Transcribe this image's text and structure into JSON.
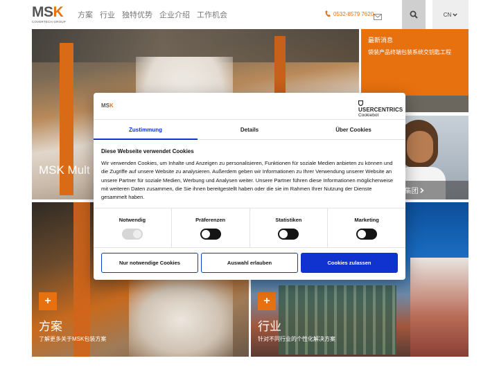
{
  "header": {
    "logo": {
      "main": "MS",
      "accent": "K",
      "sub": "COVERTECH GROUP"
    },
    "nav": [
      "方案",
      "行业",
      "独特优势",
      "企业介绍",
      "工作机会"
    ],
    "phone": "0532-8579 7620",
    "language": "CN"
  },
  "hero": {
    "title": "MSK Mult"
  },
  "news": {
    "title": "最新消息",
    "text": "袋装产品终端包装系统交钥匙工程"
  },
  "people": {
    "text": "K集团"
  },
  "tiles": [
    {
      "plus": "+",
      "title": "方案",
      "subtitle": "了解更多关于MSK包装方案"
    },
    {
      "plus": "+",
      "title": "行业",
      "subtitle": "针对不同行业的个性化解决方案"
    }
  ],
  "cookie_dialog": {
    "logo": {
      "main": "MS",
      "accent": "K"
    },
    "provider": {
      "name": "USERCENTRICS",
      "product": "Cookiebot"
    },
    "tabs": [
      {
        "label": "Zustimmung",
        "active": true
      },
      {
        "label": "Details",
        "active": false
      },
      {
        "label": "Über Cookies",
        "active": false
      }
    ],
    "heading": "Diese Webseite verwendet Cookies",
    "body": "Wir verwenden Cookies, um Inhalte und Anzeigen zu personalisieren, Funktionen für soziale Medien anbieten zu können und die Zugriffe auf unsere Website zu analysieren. Außerdem geben wir Informationen zu Ihrer Verwendung unserer Website an unsere Partner für soziale Medien, Werbung und Analysen weiter. Unsere Partner führen diese Informationen möglicherweise mit weiteren Daten zusammen, die Sie ihnen bereitgestellt haben oder die sie im Rahmen Ihrer Nutzung der Dienste gesammelt haben.",
    "categories": [
      {
        "label": "Notwendig",
        "enabled": true,
        "locked": true
      },
      {
        "label": "Präferenzen",
        "enabled": false,
        "locked": false
      },
      {
        "label": "Statistiken",
        "enabled": false,
        "locked": false
      },
      {
        "label": "Marketing",
        "enabled": false,
        "locked": false
      }
    ],
    "buttons": {
      "necessary_only": "Nur notwendige Cookies",
      "allow_selection": "Auswahl erlauben",
      "allow_all": "Cookies zulassen"
    },
    "colors": {
      "accent": "#1032cf",
      "brand": "#e8710f"
    }
  }
}
